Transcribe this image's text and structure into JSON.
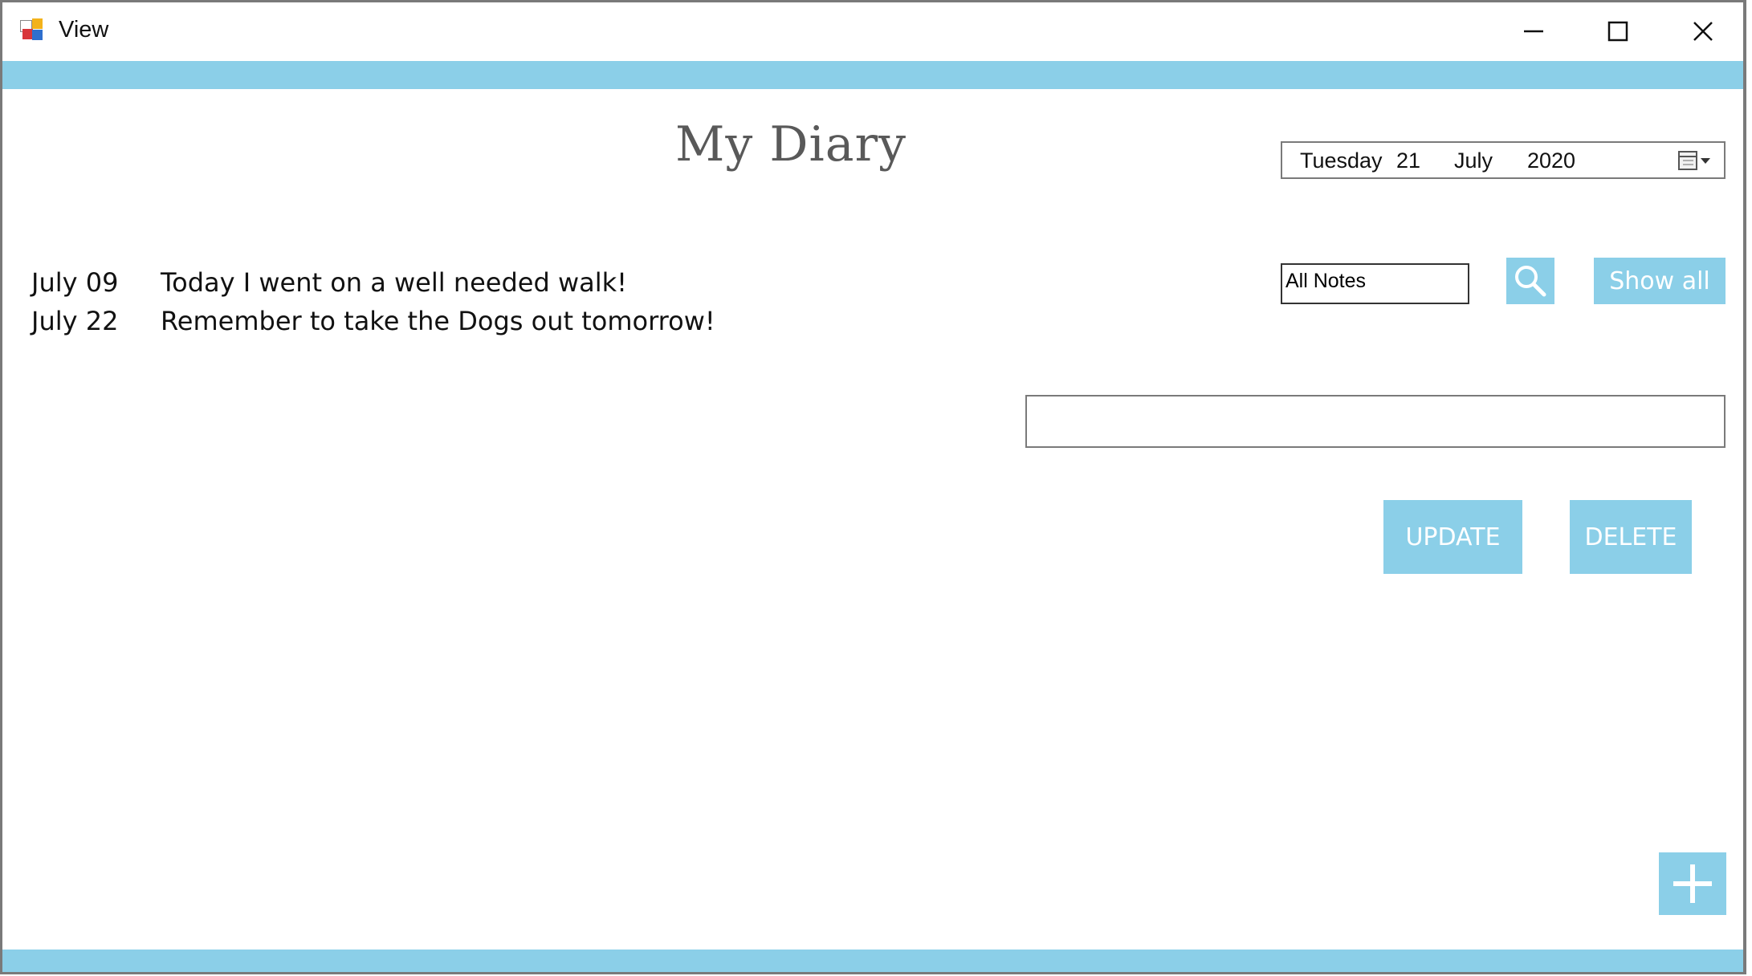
{
  "window": {
    "title": "View",
    "icon": "windows-forms-app-icon",
    "controls": [
      "minimize-icon",
      "maximize-icon",
      "close-icon"
    ]
  },
  "colors": {
    "accent": "#8bcfe8",
    "title_text": "#595959",
    "button_text": "#ffffff"
  },
  "app": {
    "title": "My Diary"
  },
  "date_picker": {
    "weekday": "Tuesday",
    "day": "21",
    "month": "July",
    "year": "2020",
    "icon": "calendar-dropdown-icon"
  },
  "entries": [
    {
      "date": "July 09",
      "text": "Today I went on a well needed walk!"
    },
    {
      "date": "July 22",
      "text": "Remember to take the Dogs out tomorrow!"
    }
  ],
  "filter": {
    "value": "All Notes"
  },
  "search_button": {
    "icon": "search-icon"
  },
  "show_all_label": "Show all",
  "note_input": {
    "value": ""
  },
  "update_label": "UPDATE",
  "delete_label": "DELETE",
  "add_button": {
    "icon": "plus-icon"
  }
}
